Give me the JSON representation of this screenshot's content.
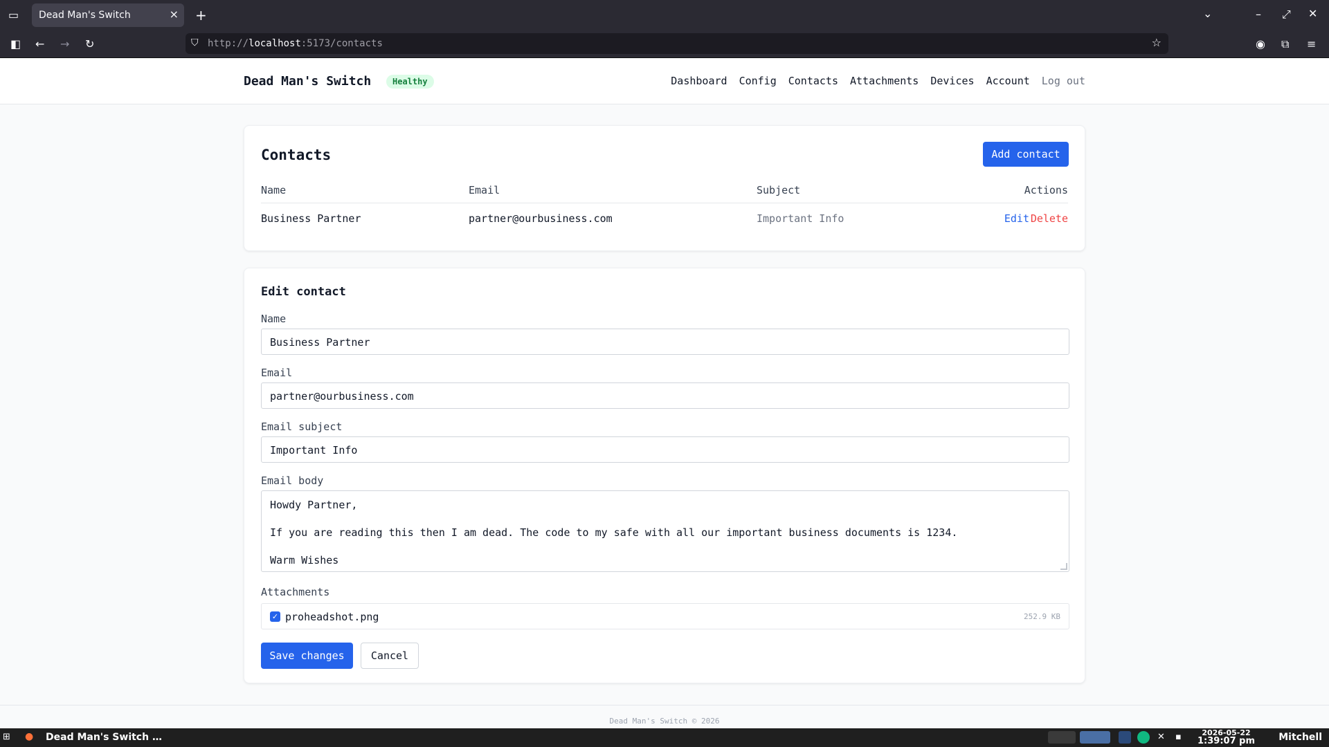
{
  "browser": {
    "tab_title": "Dead Man's Switch",
    "url_prefix": "http://",
    "url_host": "localhost",
    "url_rest": ":5173/contacts"
  },
  "app": {
    "brand": "Dead Man's Switch",
    "status_badge": "Healthy",
    "nav": [
      "Dashboard",
      "Config",
      "Contacts",
      "Attachments",
      "Devices",
      "Account",
      "Log out"
    ]
  },
  "contacts": {
    "title": "Contacts",
    "add_button": "Add contact",
    "columns": [
      "Name",
      "Email",
      "Subject",
      "Actions"
    ],
    "rows": [
      {
        "name": "Business Partner",
        "email": "partner@ourbusiness.com",
        "subject": "Important Info",
        "edit": "Edit",
        "delete": "Delete"
      }
    ]
  },
  "edit_form": {
    "title": "Edit contact",
    "name_label": "Name",
    "name_value": "Business Partner",
    "email_label": "Email",
    "email_value": "partner@ourbusiness.com",
    "subject_label": "Email subject",
    "subject_value": "Important Info",
    "body_label": "Email body",
    "body_lines": [
      "Howdy Partner,",
      "",
      "If you are reading this then I am dead. The code to my safe with all our important business documents is 1234.",
      "",
      "Warm Wishes"
    ],
    "attachments_label": "Attachments",
    "attachment": {
      "filename": "proheadshot.png",
      "size": "252.9 KB",
      "checked": true
    },
    "save_button": "Save changes",
    "cancel_button": "Cancel"
  },
  "footer": "Dead Man's Switch © 2026",
  "taskbar": {
    "app_label": "Dead Man's Switch …",
    "date": "2026-05-22",
    "time": "1:39:07 pm",
    "user": "Mitchell"
  },
  "colors": {
    "primary": "#2563eb",
    "danger": "#ef4444",
    "healthy_bg": "#dcfce7",
    "healthy_text": "#15803d"
  }
}
